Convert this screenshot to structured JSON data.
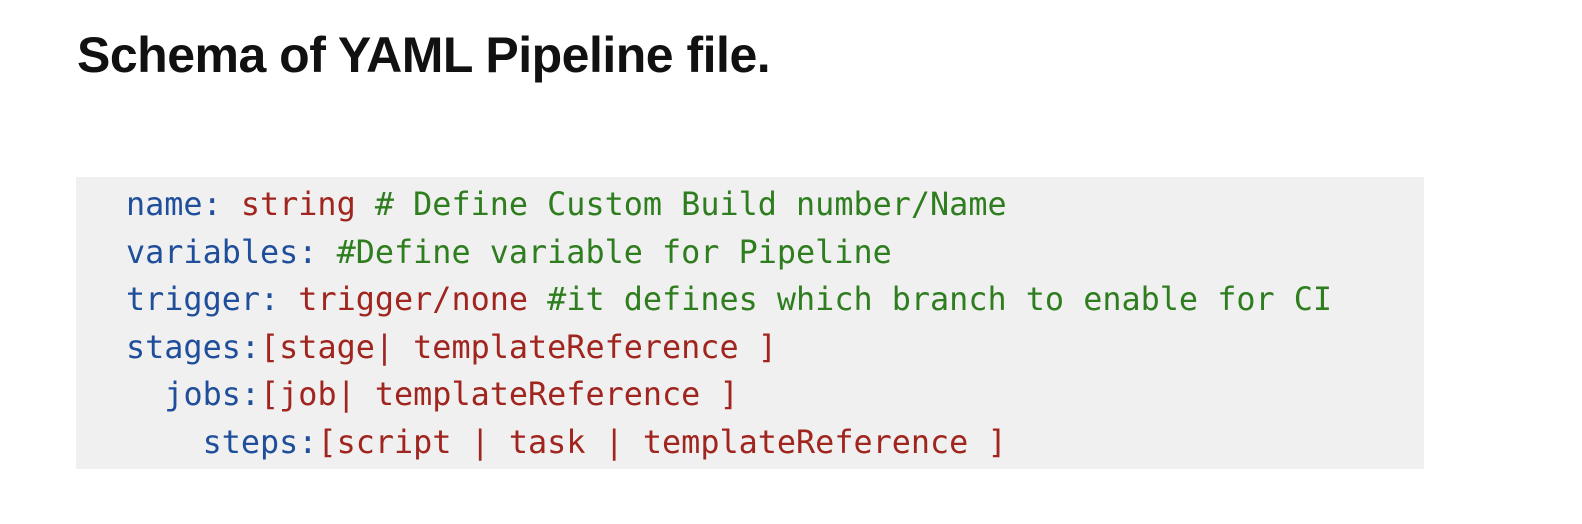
{
  "heading": "Schema of YAML Pipeline file.",
  "colors": {
    "key": "#1f4e9a",
    "value": "#a0251f",
    "comment": "#2e7d1e",
    "code_background": "#f0f0f0"
  },
  "code": {
    "lines": [
      {
        "indent": "",
        "key": "name:",
        "value": " string",
        "comment": " # Define Custom Build number/Name"
      },
      {
        "indent": "",
        "key": "variables:",
        "value": "",
        "comment": " #Define variable for Pipeline"
      },
      {
        "indent": "",
        "key": "trigger:",
        "value": " trigger/none",
        "comment": " #it defines which branch to enable for CI"
      },
      {
        "indent": "",
        "key": "stages:",
        "value": "[stage| templateReference ]",
        "comment": ""
      },
      {
        "indent": "  ",
        "key": "jobs:",
        "value": "[job| templateReference ]",
        "comment": ""
      },
      {
        "indent": "    ",
        "key": "steps:",
        "value": "[script | task | templateReference ]",
        "comment": ""
      }
    ]
  }
}
